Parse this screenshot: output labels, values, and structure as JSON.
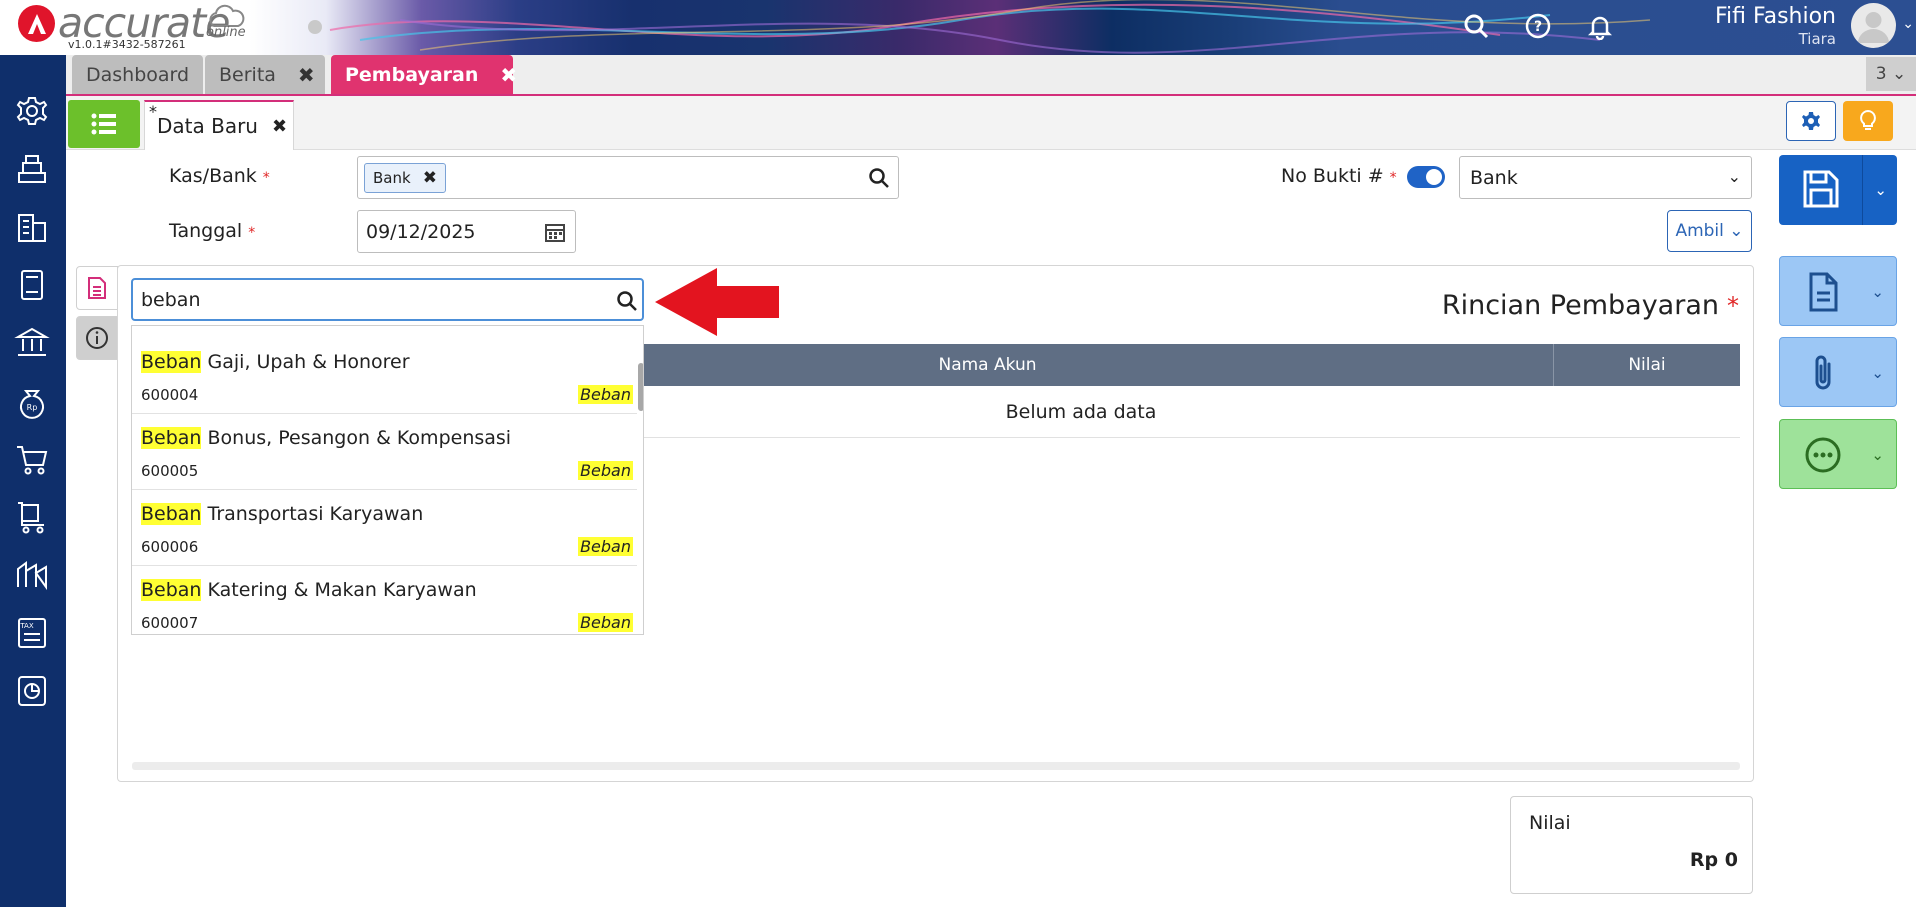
{
  "app": {
    "logo_text": "accurate",
    "logo_sub": "online",
    "version": "v1.0.1#3432-587261",
    "company": "Fifi Fashion",
    "user": "Tiara"
  },
  "tabs": [
    {
      "label": "Dashboard"
    },
    {
      "label": "Berita"
    },
    {
      "label": "Pembayaran"
    }
  ],
  "tabs_count": "3 ⌄",
  "subtab": {
    "label": "Data Baru",
    "modified_mark": "*"
  },
  "form": {
    "kas_bank_label": "Kas/Bank",
    "kas_bank_chip": "Bank",
    "tanggal_label": "Tanggal",
    "tanggal_value": "09/12/2025",
    "no_bukti_label": "No Bukti #",
    "no_bukti_select": "Bank",
    "required_mark": "*",
    "ambil_label": "Ambil ⌄"
  },
  "panel": {
    "title": "Rincian Pembayaran",
    "col_name": "Nama Akun",
    "col_value": "Nilai",
    "empty_text": "Belum ada data"
  },
  "search": {
    "value": "beban",
    "results": [
      {
        "highlight": "Beban",
        "rest": " Gaji, Upah & Honorer",
        "code": "600004",
        "type": "Beban"
      },
      {
        "highlight": "Beban",
        "rest": " Bonus, Pesangon & Kompensasi",
        "code": "600005",
        "type": "Beban"
      },
      {
        "highlight": "Beban",
        "rest": " Transportasi Karyawan",
        "code": "600006",
        "type": "Beban"
      },
      {
        "highlight": "Beban",
        "rest": " Katering & Makan Karyawan",
        "code": "600007",
        "type": "Beban"
      }
    ]
  },
  "summary": {
    "label": "Nilai",
    "value": "Rp 0"
  },
  "colors": {
    "accent": "#d32e7a",
    "primary": "#1762c4",
    "sidebar": "#0f2f6b",
    "highlight": "#ffff33"
  }
}
